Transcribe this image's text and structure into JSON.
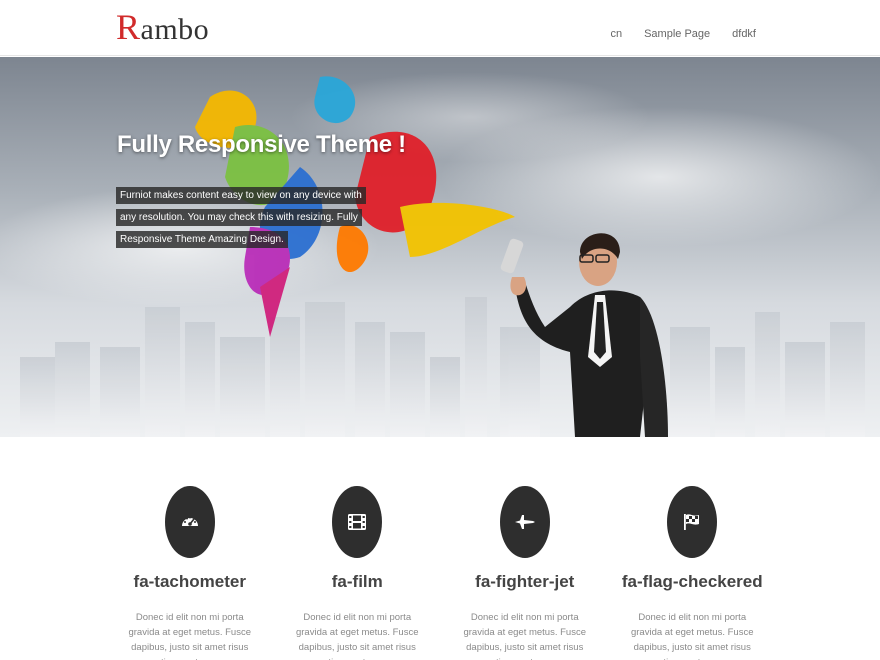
{
  "header": {
    "logo_first": "R",
    "logo_rest": "ambo",
    "nav": [
      "cn",
      "Sample Page",
      "dfdkf"
    ]
  },
  "hero": {
    "title": "Fully Responsive Theme !",
    "description": "Furniot makes content easy to view on any device with any resolution. You may check this with resizing. Fully Responsive Theme Amazing Design."
  },
  "features": [
    {
      "icon": "tachometer-icon",
      "title": "fa-tachometer",
      "text": "Donec id elit non mi porta gravida at eget metus. Fusce dapibus, justo sit amet risus etiam porta sem"
    },
    {
      "icon": "film-icon",
      "title": "fa-film",
      "text": "Donec id elit non mi porta gravida at eget metus. Fusce dapibus, justo sit amet risus etiam porta sem"
    },
    {
      "icon": "fighter-jet-icon",
      "title": "fa-fighter-jet",
      "text": "Donec id elit non mi porta gravida at eget metus. Fusce dapibus, justo sit amet risus etiam porta sem"
    },
    {
      "icon": "flag-checkered-icon",
      "title": "fa-flag-checkered",
      "text": "Donec id elit non mi porta gravida at eget metus. Fusce dapibus, justo sit amet risus etiam porta sem"
    }
  ],
  "colors": {
    "logo_accent": "#d12b2b",
    "icon_circle": "#2e2e2e"
  }
}
